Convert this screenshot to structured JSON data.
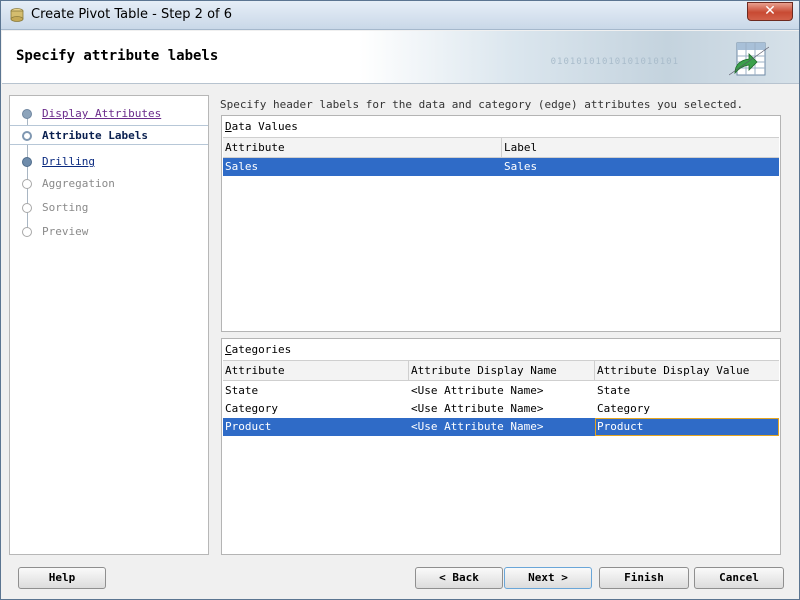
{
  "window": {
    "title": "Create Pivot Table - Step 2 of 6",
    "close_label": "✕"
  },
  "header": {
    "title": "Specify attribute labels",
    "binary_text": "01010101010101010101"
  },
  "steps": [
    {
      "label": "Display Attributes",
      "state": "done"
    },
    {
      "label": "Attribute Labels",
      "state": "current"
    },
    {
      "label": "Drilling",
      "state": "link"
    },
    {
      "label": "Aggregation",
      "state": "todo"
    },
    {
      "label": "Sorting",
      "state": "todo"
    },
    {
      "label": "Preview",
      "state": "todo"
    }
  ],
  "instruction": "Specify header labels for the data and category (edge) attributes you selected.",
  "data_values": {
    "title": "Data Values",
    "columns": [
      "Attribute",
      "Label"
    ],
    "rows": [
      {
        "attribute": "Sales",
        "label": "Sales",
        "selected": true
      }
    ]
  },
  "categories": {
    "title": "Categories",
    "columns": [
      "Attribute",
      "Attribute Display Name",
      "Attribute Display Value"
    ],
    "rows": [
      {
        "attribute": "State",
        "display_name": "<Use Attribute Name>",
        "display_value": "State",
        "selected": false
      },
      {
        "attribute": "Category",
        "display_name": "<Use Attribute Name>",
        "display_value": "Category",
        "selected": false
      },
      {
        "attribute": "Product",
        "display_name": "<Use Attribute Name>",
        "display_value": "Product",
        "selected": true
      }
    ]
  },
  "footer": {
    "help_label": "Help",
    "back_label": "< Back",
    "next_label": "Next >",
    "finish_label": "Finish",
    "cancel_label": "Cancel"
  },
  "colors": {
    "selection": "#2f6bc7",
    "focus_border": "#e3a522",
    "visited_link": "#6a2a8a",
    "link": "#0a2a80"
  }
}
